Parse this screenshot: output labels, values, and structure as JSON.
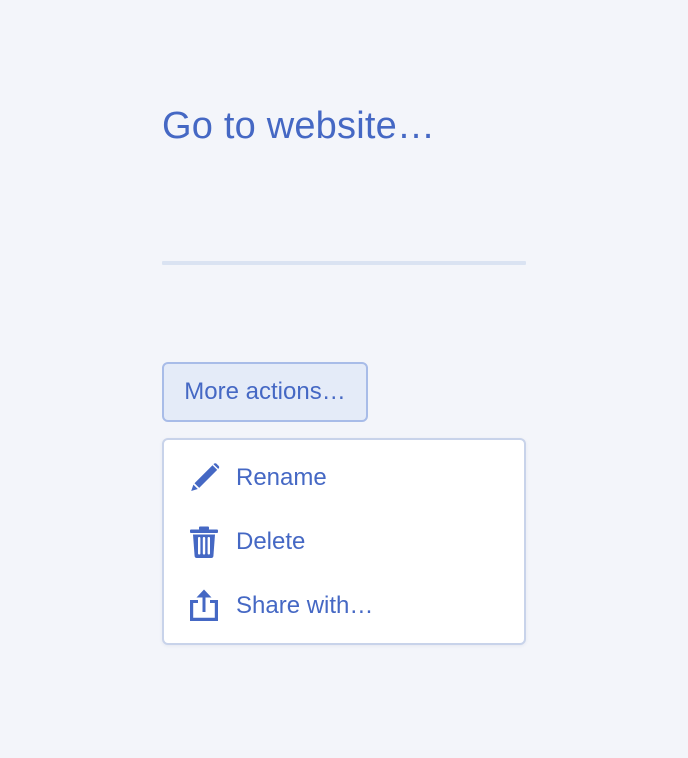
{
  "link": {
    "text": "Go to website…"
  },
  "actions_button": {
    "label": "More actions…"
  },
  "menu": {
    "items": [
      {
        "label": "Rename",
        "icon": "pencil-icon"
      },
      {
        "label": "Delete",
        "icon": "trash-icon"
      },
      {
        "label": "Share with…",
        "icon": "share-icon"
      }
    ]
  },
  "colors": {
    "accent": "#4568c4",
    "background": "#f3f5fa",
    "button_bg": "#e4ebf8",
    "button_border": "#a8bce8",
    "menu_bg": "#ffffff",
    "divider": "#dae3f2"
  }
}
